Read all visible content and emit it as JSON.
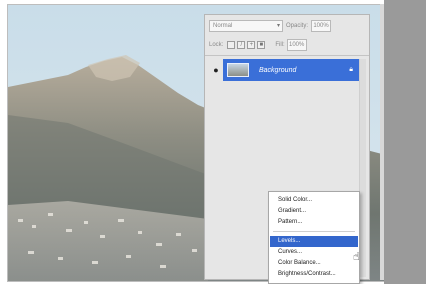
{
  "layers_panel": {
    "blend_mode": "Normal",
    "opacity_label": "Opacity:",
    "opacity_value": "100%",
    "lock_label": "Lock:",
    "fill_label": "Fill:",
    "fill_value": "100%",
    "layers": [
      {
        "name": "Background",
        "visible": true,
        "selected": true
      }
    ]
  },
  "context_menu": {
    "items": [
      "Solid Color...",
      "Gradient...",
      "Pattern...",
      "Levels...",
      "Curves...",
      "Color Balance...",
      "Brightness/Contrast..."
    ],
    "highlighted": "Levels..."
  },
  "colors": {
    "selection": "#3a6fd8",
    "menu_highlight": "#3366cc",
    "panel_bg": "#e6e6e6"
  },
  "icons": [
    "eye-icon",
    "lock-icon",
    "cursor-icon",
    "chevron-down-icon"
  ]
}
